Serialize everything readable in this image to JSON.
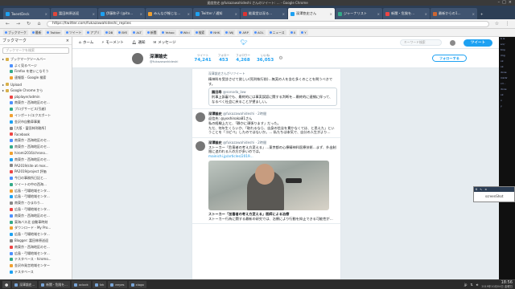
{
  "window": {
    "title": "速度悠史 @fukazawahideshi さんのツイート: … - Google Chrome"
  },
  "tabs": [
    {
      "label": "TweetDeck",
      "color": "#1da1f2",
      "active": false
    },
    {
      "label": "冨田林原送迎",
      "color": "#e0473c",
      "active": false
    },
    {
      "label": "伊藤和子 (@ito...",
      "color": "#1da1f2",
      "active": false
    },
    {
      "label": "みんなが報じな...",
      "color": "#f0a030",
      "active": false
    },
    {
      "label": "Twitter / 通知",
      "color": "#1da1f2",
      "active": false
    },
    {
      "label": "能楽堂は深る...",
      "color": "#d33",
      "active": false
    },
    {
      "label": "深澤悠史さん",
      "color": "#1da1f2",
      "active": true
    },
    {
      "label": "ジャーナリスト",
      "color": "#3a8",
      "active": false
    },
    {
      "label": "新聞・危険を...",
      "color": "#e44",
      "active": false
    },
    {
      "label": "最新からの1...",
      "color": "#c63",
      "active": false
    }
  ],
  "toolbar": {
    "url": "https://twitter.com/fukazawahideshi_replies"
  },
  "bookmarks_bar": [
    "ブックマーク",
    "最新",
    "Twitter",
    "ツイート",
    "アプリ",
    "DB",
    "BYE",
    "ALT",
    "新聞",
    "Yahoo",
    "Wiki",
    "検索",
    "NHK",
    "IWJ",
    "ARP",
    "AOL",
    "ニュース",
    "X",
    "Y"
  ],
  "sidebar": {
    "title": "ブックマーク",
    "search_placeholder": "ブックマークを検索",
    "items": [
      {
        "label": "ブックマークツールバー",
        "type": "folder",
        "level": 0
      },
      {
        "label": "よく見るページ",
        "type": "link",
        "level": 1
      },
      {
        "label": "Firefox を使いこなそう",
        "type": "link",
        "level": 1
      },
      {
        "label": "速報版 - Google 検索",
        "type": "link",
        "level": 1
      },
      {
        "label": "Upload",
        "type": "folder",
        "level": 0
      },
      {
        "label": "Google Chrome から",
        "type": "folder",
        "level": 0
      },
      {
        "label": "pbplayer/admin",
        "type": "link",
        "level": 1
      },
      {
        "label": "南東京・西海地区のセ...",
        "type": "link",
        "level": 1
      },
      {
        "label": "ブログサービス(引越)",
        "type": "link",
        "level": 1
      },
      {
        "label": "インポート/エクスポート",
        "type": "link",
        "level": 1
      },
      {
        "label": "金沢市自動車事業",
        "type": "link",
        "level": 1
      },
      {
        "label": "[大阪・冨田林刑務所]",
        "type": "link",
        "level": 1
      },
      {
        "label": "Facebook",
        "type": "link",
        "level": 1
      },
      {
        "label": "南東京・西海地区のセ...",
        "type": "link",
        "level": 1
      },
      {
        "label": "南東京・西海地区のセ...",
        "type": "link",
        "level": 1
      },
      {
        "label": "hiromi2016/chrono...",
        "type": "link",
        "level": 1
      },
      {
        "label": "南東京・西海地区のセ...",
        "type": "link",
        "level": 1
      },
      {
        "label": "PA2019/site at mos...",
        "type": "link",
        "level": 1
      },
      {
        "label": "PA2019/project 評価",
        "type": "link",
        "level": 1
      },
      {
        "label": "今日の事務所日記と…",
        "type": "link",
        "level": 1
      },
      {
        "label": "ツイートの中の西海…",
        "type": "link",
        "level": 1
      },
      {
        "label": "広島・弓場地域センタ...",
        "type": "link",
        "level": 1
      },
      {
        "label": "広島・弓場地域センタ...",
        "type": "link",
        "level": 1
      },
      {
        "label": "南東京・ひまわり…",
        "type": "link",
        "level": 1
      },
      {
        "label": "広島・弓場地域センタ...",
        "type": "link",
        "level": 1
      },
      {
        "label": "南東京・西海地区のセ...",
        "type": "link",
        "level": 1
      },
      {
        "label": "東海バス北 自動車時刻",
        "type": "link",
        "level": 1
      },
      {
        "label": "ダウンロード - My Pro...",
        "type": "link",
        "level": 1
      },
      {
        "label": "広島・弓場地域センタ...",
        "type": "link",
        "level": 1
      },
      {
        "label": "Blogger: 冨田林原送迎",
        "type": "link",
        "level": 1
      },
      {
        "label": "南東京・西海地区のセ...",
        "type": "link",
        "level": 1
      },
      {
        "label": "広島・弓場地域センタ...",
        "type": "link",
        "level": 1
      },
      {
        "label": "テスタベース - hiromo...",
        "type": "link",
        "level": 1
      },
      {
        "label": "金沢市発言地域センター",
        "type": "link",
        "level": 1
      },
      {
        "label": "テスタベース",
        "type": "link",
        "level": 1
      }
    ]
  },
  "twitter_nav": {
    "home": "ホーム",
    "moments": "モーメント",
    "notifications": "通知",
    "messages": "メッセージ",
    "search_placeholder": "キーワード検索",
    "tweet_button": "ツイート"
  },
  "profile": {
    "name": "深澤諭史",
    "handle": "@fukazawahideshi",
    "stats": [
      {
        "label": "ツイート",
        "value": "74,241"
      },
      {
        "label": "フォロー",
        "value": "453"
      },
      {
        "label": "フォロワー",
        "value": "4,268"
      },
      {
        "label": "いいね",
        "value": "36,053"
      }
    ],
    "follow_button": "フォローする"
  },
  "tweets": [
    {
      "meta": "深澤諭史さんがリツイート",
      "name": "",
      "handle": "",
      "body": "精神科を受診させて欲しい(死刑執行前)…無実の人を含む多くのことを問うべきです。",
      "quote": {
        "name": "園田寿",
        "handle": "@sonoda_law",
        "text": "刑事上訴審でも、最終的には事実誤認に関する判断を…最終的に速捕に伴って、なるべく社会に戻ることが望ましい。"
      }
    },
    {
      "meta": "",
      "name": "深澤諭史",
      "handle": "@fukazawahideshi · 2時間",
      "body": "返信先: @yoshinaka81さん\n私の経験上だと、「静かに頑張ります」だった。\nただ、何年生くらいか、「取れるなら、自身の信念を貫かなくては、と思えた」ということを「コピペ」したのではないか。… 私たちは本気で、自分の人生がより…",
      "quote": null
    },
    {
      "meta": "",
      "name": "深澤諭史",
      "handle": "@fukazawahideshi · 2時間",
      "body": "ストーカー「危害者の考え方変える」…東京都の心療精神科医療技術…まず、外出制限に追われる人の方が多いのでは。",
      "link": "mainichi.jp/articles/2019...",
      "card_title": "ストーカー「加害者の考え方変える」医師による治療",
      "card_text": "ストーカー行為に関する最新の研究では、治療により行動を抑止できる可能性が…"
    }
  ],
  "taskbar": {
    "items": [
      "深澤諭史…",
      "新聞・危険を…",
      "xclock",
      "fzk",
      "eeyes",
      "xlogo"
    ],
    "ime": "jp",
    "time": "18:56",
    "date": "2019年10月04日 金曜日"
  },
  "terminal_lines": [
    "$ ls",
    "src/",
    "tmp",
    "img",
    "ok",
    "ok",
    "done",
    "mkdir",
    "cd ..",
    "done",
    "ok",
    "x",
    "y"
  ],
  "screenshot_window": {
    "label": "screenShot"
  }
}
